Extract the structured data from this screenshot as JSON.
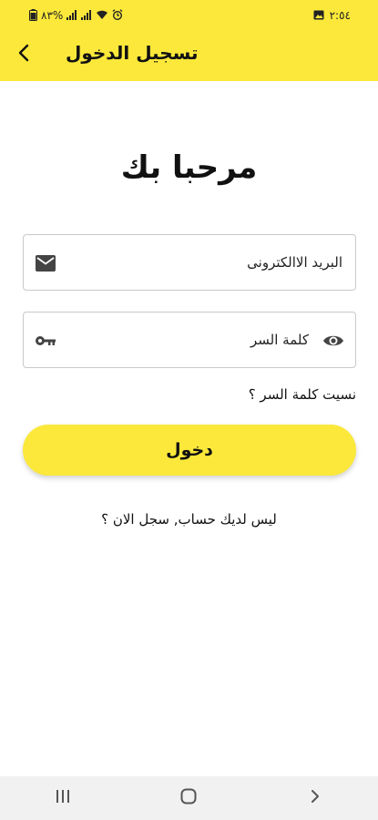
{
  "status_bar": {
    "time": "٢:٥٤",
    "battery": "٨٣%",
    "icons": [
      "battery-icon",
      "signal-icon",
      "signal-icon",
      "wifi-icon",
      "alarm-icon",
      "gallery-icon"
    ]
  },
  "header": {
    "title": "تسجيل الدخول",
    "back_icon": "chevron-left-icon",
    "color": "#fbe83a"
  },
  "main": {
    "welcome": "مرحبا بك",
    "email": {
      "placeholder": "البريد الاالكترونى",
      "value": "",
      "icon": "mail-icon"
    },
    "password": {
      "placeholder": "كلمة السر",
      "value": "",
      "icon": "key-icon",
      "toggle_icon": "eye-icon"
    },
    "forgot_password": "نسيت كلمة السر ؟",
    "login_button": "دخول",
    "register_prompt": "ليس لديك حساب, سجل الان ؟"
  },
  "nav_bar": {
    "buttons": [
      "recent-apps-icon",
      "home-icon",
      "back-icon"
    ]
  }
}
